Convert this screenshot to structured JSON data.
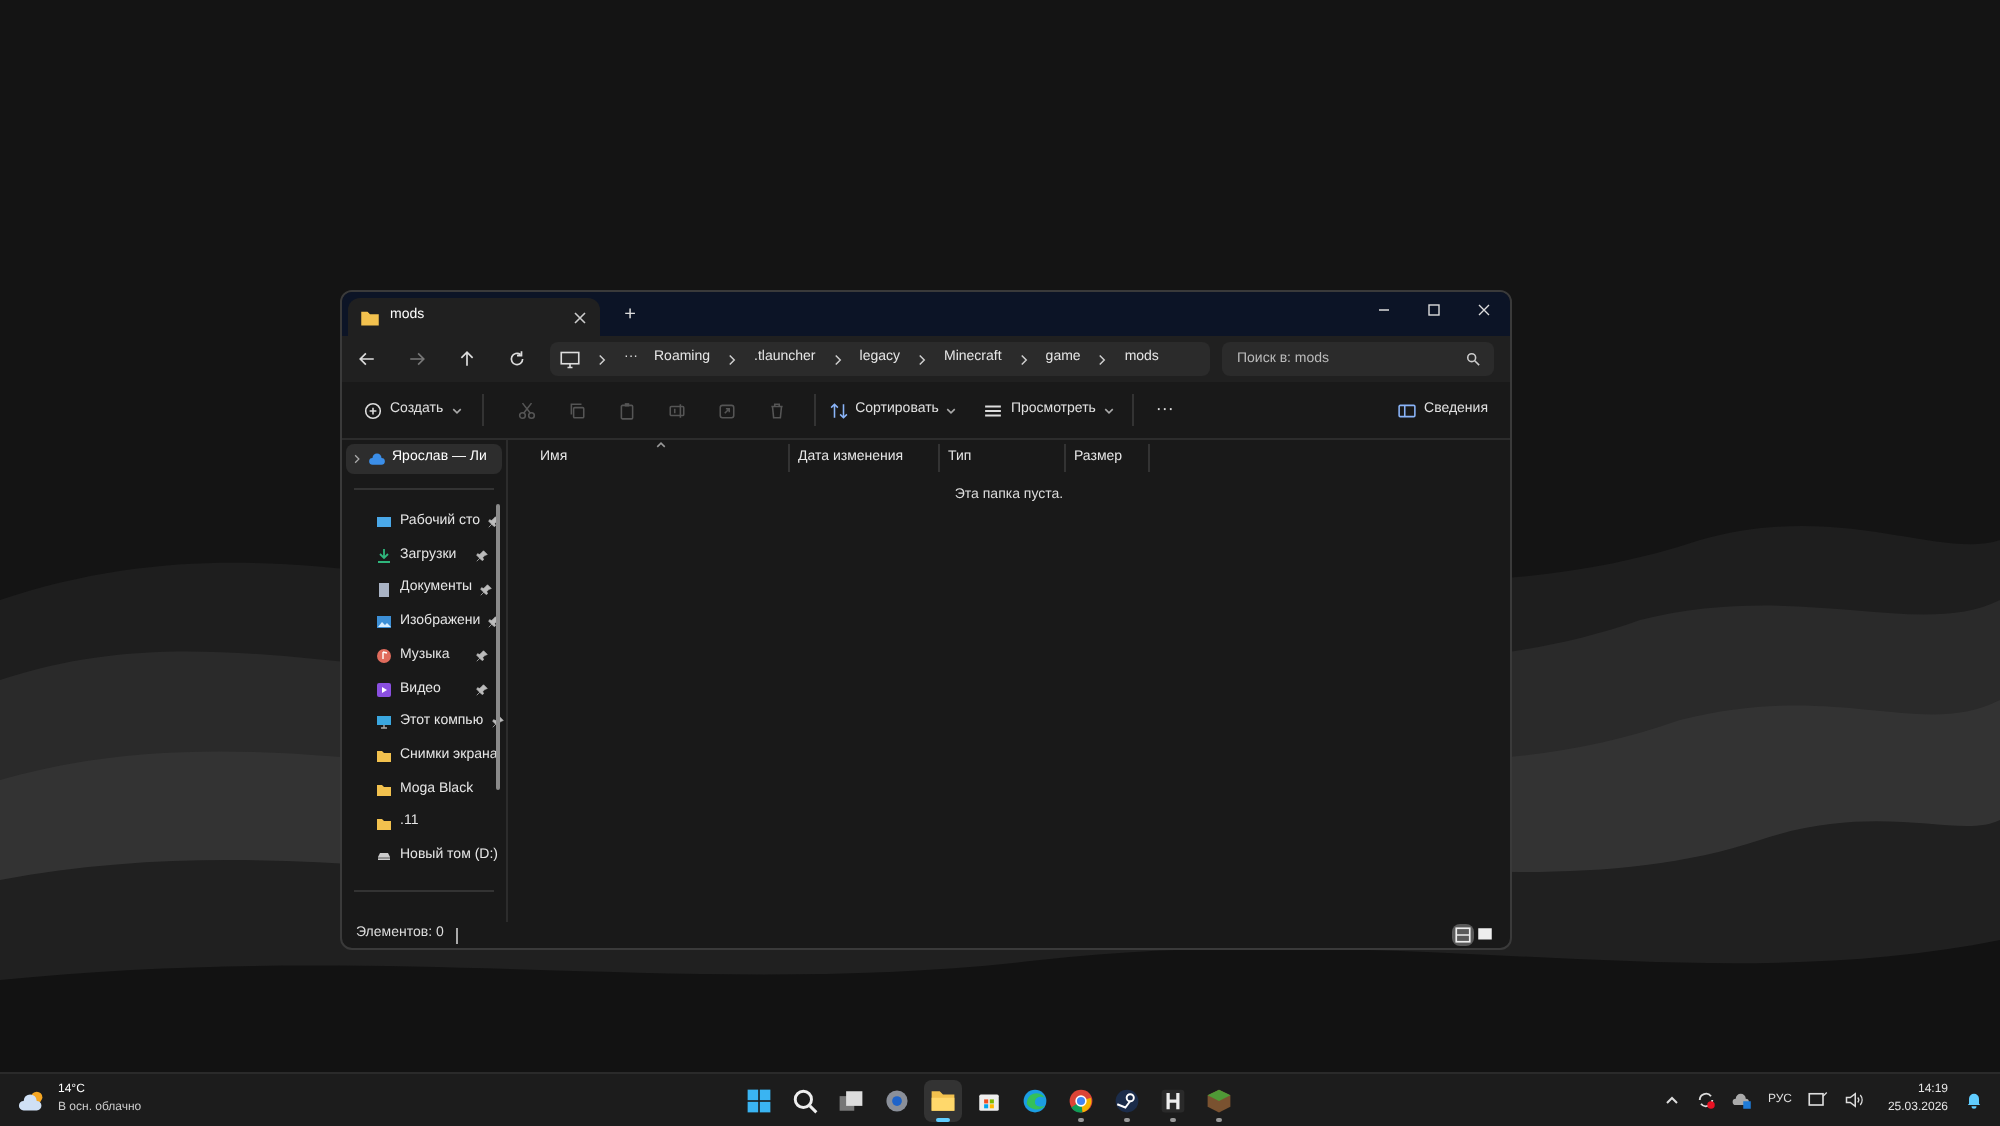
{
  "window": {
    "tab_title": "mods",
    "new_tab": "+"
  },
  "address": {
    "crumbs": [
      "Roaming",
      ".tlauncher",
      "legacy",
      "Minecraft",
      "game",
      "mods"
    ],
    "overflow": "···"
  },
  "search": {
    "placeholder": "Поиск в: mods"
  },
  "toolbar": {
    "create": "Создать",
    "sort": "Сортировать",
    "view": "Просмотреть",
    "more": "···",
    "details": "Сведения"
  },
  "sidebar": {
    "top": {
      "label": "Ярослав — Ли",
      "selected": true
    },
    "items": [
      {
        "label": "Рабочий сто",
        "kind": "desktop",
        "pinned": true
      },
      {
        "label": "Загрузки",
        "kind": "downloads",
        "pinned": true
      },
      {
        "label": "Документы",
        "kind": "documents",
        "pinned": true
      },
      {
        "label": "Изображени",
        "kind": "pictures",
        "pinned": true
      },
      {
        "label": "Музыка",
        "kind": "music",
        "pinned": true
      },
      {
        "label": "Видео",
        "kind": "video",
        "pinned": true
      },
      {
        "label": "Этот компью",
        "kind": "computer",
        "pinned": true
      },
      {
        "label": "Снимки экрана",
        "kind": "folder",
        "pinned": false
      },
      {
        "label": "Moga Black",
        "kind": "folder",
        "pinned": false
      },
      {
        "label": ".11",
        "kind": "folder",
        "pinned": false
      },
      {
        "label": "Новый том (D:)",
        "kind": "drive",
        "pinned": false
      }
    ]
  },
  "table": {
    "columns": [
      "Имя",
      "Дата изменения",
      "Тип",
      "Размер"
    ],
    "empty_message": "Эта папка пуста."
  },
  "status_bar": {
    "count": "Элементов: 0",
    "views": [
      {
        "kind": "details",
        "selected": true
      },
      {
        "kind": "tiles",
        "selected": false
      }
    ]
  },
  "taskbar": {
    "weather": {
      "temp": "14°C",
      "text": "В осн. облачно"
    },
    "apps": [
      {
        "kind": "start",
        "selected": false,
        "running": false
      },
      {
        "kind": "search",
        "selected": false,
        "running": false
      },
      {
        "kind": "taskview",
        "selected": false,
        "running": false
      },
      {
        "kind": "settings",
        "selected": false,
        "running": false
      },
      {
        "kind": "explorer",
        "selected": true,
        "running": true
      },
      {
        "kind": "store",
        "selected": false,
        "running": false
      },
      {
        "kind": "edge",
        "selected": false,
        "running": false
      },
      {
        "kind": "chrome",
        "selected": false,
        "running": true
      },
      {
        "kind": "steam",
        "selected": false,
        "running": true
      },
      {
        "kind": "h",
        "selected": false,
        "running": true
      },
      {
        "kind": "grass",
        "selected": false,
        "running": true
      }
    ],
    "language": "РУС",
    "time": "14:19",
    "date": "25.03.2026"
  }
}
